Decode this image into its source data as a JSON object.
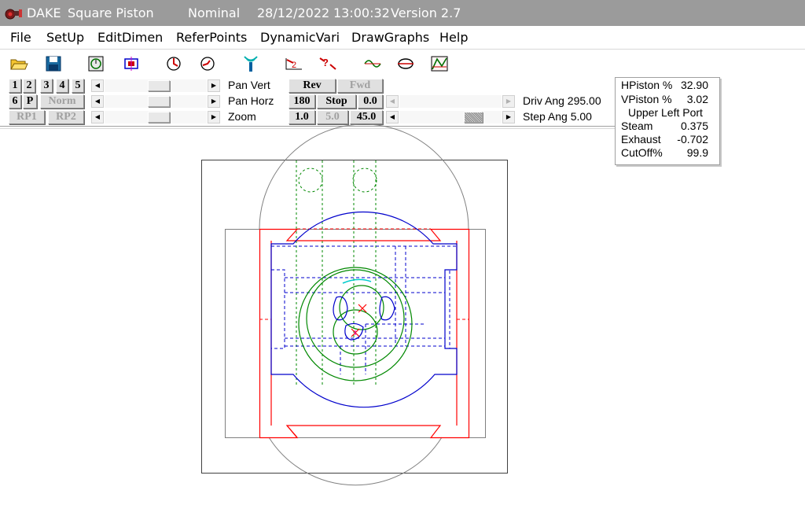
{
  "window": {
    "app_name": "DAKE",
    "doc_title": "Square Piston",
    "mode": "Nominal",
    "date": "28/12/2022",
    "time": "13:00:32",
    "version": "Version 2.7"
  },
  "menu": [
    "File",
    "SetUp",
    "EditDimen",
    "ReferPoints",
    "DynamicVari",
    "DrawGraphs",
    "Help"
  ],
  "toolbar": [
    {
      "name": "open-folder-icon"
    },
    {
      "name": "save-disk-icon"
    },
    {
      "name": "timer-icon"
    },
    {
      "name": "piston-view-icon"
    },
    {
      "name": "rotate-forward-icon"
    },
    {
      "name": "rotate-back-icon"
    },
    {
      "name": "antenna-icon"
    },
    {
      "name": "measure-two-points-icon"
    },
    {
      "name": "measure-query-icon"
    },
    {
      "name": "graph-wave-icon"
    },
    {
      "name": "graph-ellipse-icon"
    },
    {
      "name": "graph-curves-icon"
    }
  ],
  "controls": {
    "view_buttons_row1": [
      "1",
      "2",
      "3",
      "4",
      "5"
    ],
    "view_buttons_row2": [
      "6",
      "P",
      "Norm"
    ],
    "view_buttons_row3": [
      "RP1",
      "RP2"
    ],
    "pan_vert_label": "Pan Vert",
    "pan_horz_label": "Pan Horz",
    "zoom_label": "Zoom",
    "rev_label": "Rev",
    "fwd_label": "Fwd",
    "angle_180_label": "180",
    "stop_label": "Stop",
    "angle_0_label": "0.0",
    "step_1_label": "1.0",
    "step_5_label": "5.0",
    "step_45_label": "45.0",
    "driv_ang_label": "Driv Ang 295.00",
    "step_ang_label": "Step Ang  5.00"
  },
  "info": {
    "hpiston_label": "HPiston %",
    "hpiston_value": "32.90",
    "vpiston_label": "VPiston %",
    "vpiston_value": "3.02",
    "port_label": "Upper Left Port",
    "steam_label": "Steam",
    "steam_value": "0.375",
    "exhaust_label": "Exhaust",
    "exhaust_value": "-0.702",
    "cutoff_label": "CutOff%",
    "cutoff_value": "99.9"
  },
  "colors": {
    "titlebar": "#9b9b9b",
    "body_outline": "#ff0000",
    "piston": "#0000cc",
    "valve_gear": "#008800",
    "casing": "#808080",
    "crosshair": "#ff0000",
    "highlight": "#00cccc"
  }
}
